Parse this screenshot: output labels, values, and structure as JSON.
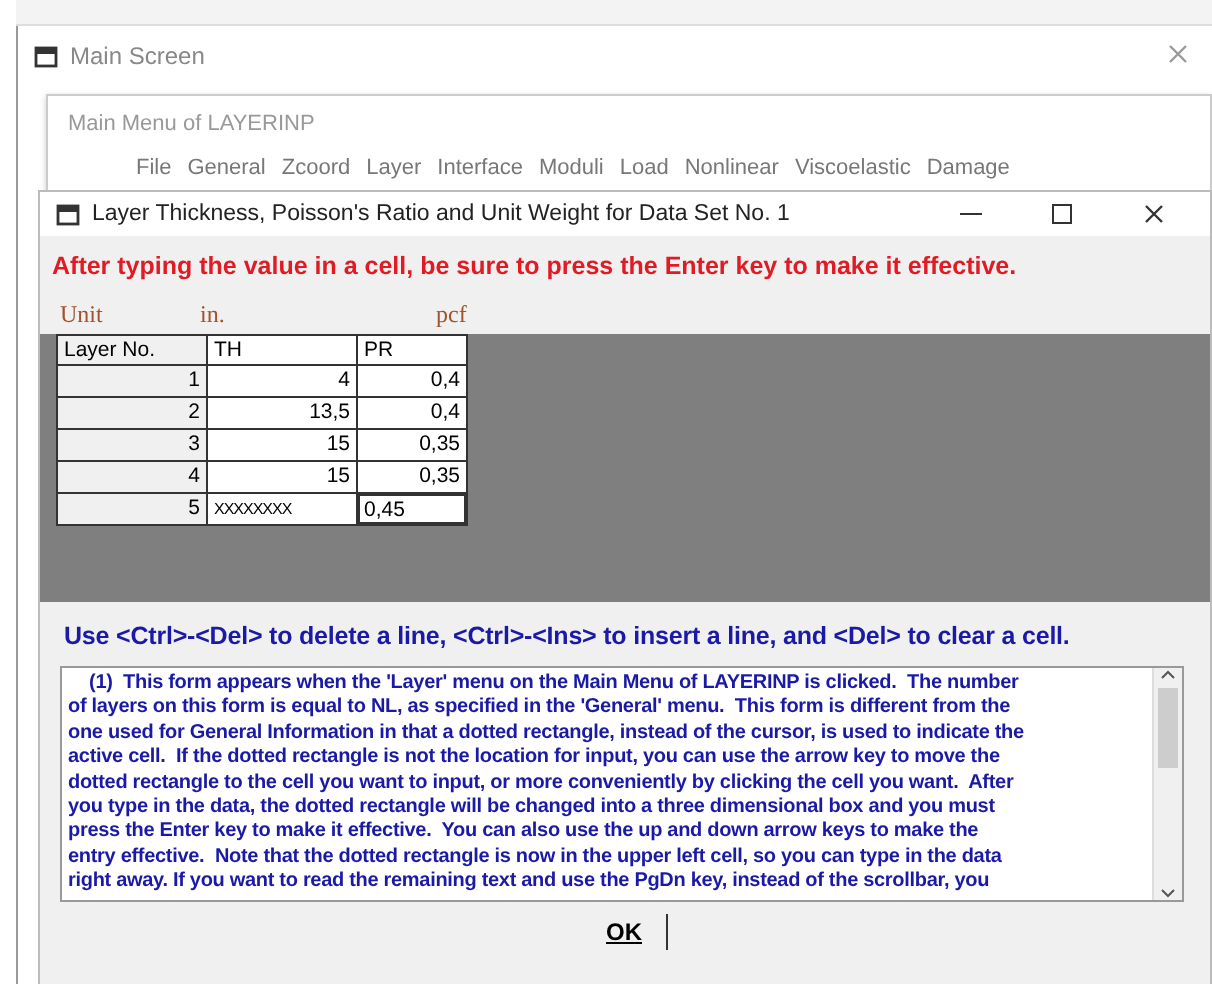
{
  "main_window": {
    "title": "Main Screen"
  },
  "main_menu": {
    "title": "Main Menu of LAYERINP",
    "items": [
      "File",
      "General",
      "Zcoord",
      "Layer",
      "Interface",
      "Moduli",
      "Load",
      "Nonlinear",
      "Viscoelastic",
      "Damage"
    ]
  },
  "dialog": {
    "title": "Layer Thickness, Poisson's Ratio and Unit Weight for Data Set No. 1",
    "warning": "After typing the value in a cell, be sure to press the Enter key to make it effective.",
    "units": [
      "Unit",
      "in.",
      "pcf"
    ],
    "table": {
      "columns": [
        "Layer No.",
        "TH",
        "PR"
      ],
      "rows": [
        {
          "cells": [
            "1",
            "4",
            "0,4"
          ],
          "editing": false
        },
        {
          "cells": [
            "2",
            "13,5",
            "0,4"
          ],
          "editing": false
        },
        {
          "cells": [
            "3",
            "15",
            "0,35"
          ],
          "editing": false
        },
        {
          "cells": [
            "4",
            "15",
            "0,35"
          ],
          "editing": false
        },
        {
          "cells": [
            "5",
            "XXXXXXXX",
            "0,45"
          ],
          "editing": true
        }
      ]
    },
    "hint": "Use <Ctrl>-<Del> to delete a line, <Ctrl>-<Ins> to insert a line, and <Del> to clear a cell.",
    "help_lines": [
      "    (1)  This form appears when the 'Layer' menu on the Main Menu of LAYERINP is clicked.  The number",
      "of layers on this form is equal to NL, as specified in the 'General' menu.  This form is different from the",
      "one used for General Information in that a dotted rectangle, instead of the cursor, is used to indicate the",
      "active cell.  If the dotted rectangle is not the location for input, you can use the arrow key to move the",
      "dotted rectangle to the cell you want to input, or more conveniently by clicking the cell you want.  After",
      "you type in the data, the dotted rectangle will be changed into a three dimensional box and you must",
      "press the Enter key to make it effective.  You can also use the up and down arrow keys to make the",
      "entry effective.  Note that the dotted rectangle is now in the upper left cell, so you can type in the data",
      "right away. If you want to read the remaining text and use the PgDn key, instead of the scrollbar, you"
    ],
    "ok_button": "OK"
  }
}
